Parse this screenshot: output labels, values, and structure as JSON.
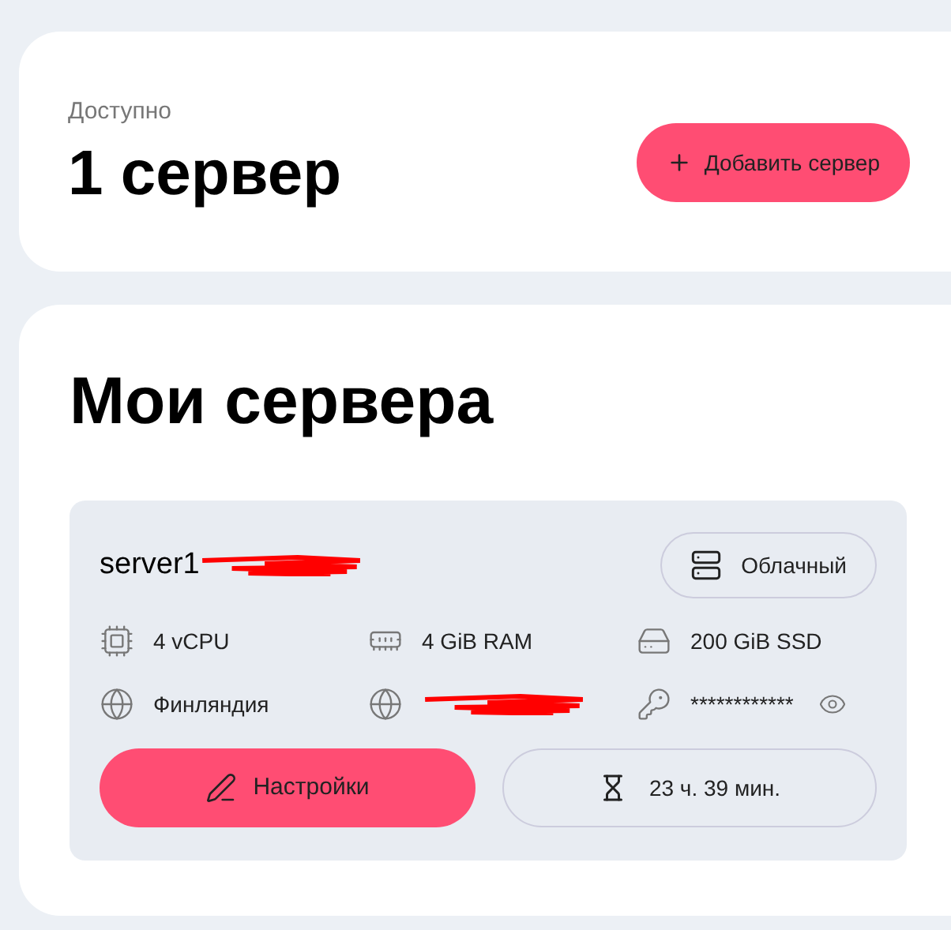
{
  "summary": {
    "label": "Доступно",
    "count": "1 сервер",
    "add_button": "Добавить сервер"
  },
  "servers_section": {
    "title": "Мои сервера",
    "servers": [
      {
        "name": "server1",
        "type": "Облачный",
        "specs": [
          {
            "kind": "cpu",
            "text": "4 vCPU"
          },
          {
            "kind": "ram",
            "text": "4 GiB RAM"
          },
          {
            "kind": "disk",
            "text": "200 GiB SSD"
          },
          {
            "kind": "location",
            "text": "Финляндия"
          },
          {
            "kind": "ip"
          },
          {
            "kind": "password",
            "text": "************"
          }
        ],
        "settings_button": "Настройки",
        "time_left": "23 ч. 39 мин."
      }
    ]
  }
}
